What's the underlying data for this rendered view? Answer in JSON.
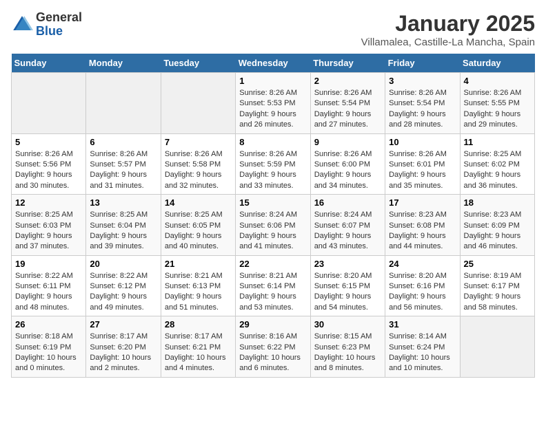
{
  "logo": {
    "general": "General",
    "blue": "Blue"
  },
  "title": "January 2025",
  "subtitle": "Villamalea, Castille-La Mancha, Spain",
  "days_of_week": [
    "Sunday",
    "Monday",
    "Tuesday",
    "Wednesday",
    "Thursday",
    "Friday",
    "Saturday"
  ],
  "weeks": [
    [
      {
        "day": "",
        "info": ""
      },
      {
        "day": "",
        "info": ""
      },
      {
        "day": "",
        "info": ""
      },
      {
        "day": "1",
        "info": "Sunrise: 8:26 AM\nSunset: 5:53 PM\nDaylight: 9 hours and 26 minutes."
      },
      {
        "day": "2",
        "info": "Sunrise: 8:26 AM\nSunset: 5:54 PM\nDaylight: 9 hours and 27 minutes."
      },
      {
        "day": "3",
        "info": "Sunrise: 8:26 AM\nSunset: 5:54 PM\nDaylight: 9 hours and 28 minutes."
      },
      {
        "day": "4",
        "info": "Sunrise: 8:26 AM\nSunset: 5:55 PM\nDaylight: 9 hours and 29 minutes."
      }
    ],
    [
      {
        "day": "5",
        "info": "Sunrise: 8:26 AM\nSunset: 5:56 PM\nDaylight: 9 hours and 30 minutes."
      },
      {
        "day": "6",
        "info": "Sunrise: 8:26 AM\nSunset: 5:57 PM\nDaylight: 9 hours and 31 minutes."
      },
      {
        "day": "7",
        "info": "Sunrise: 8:26 AM\nSunset: 5:58 PM\nDaylight: 9 hours and 32 minutes."
      },
      {
        "day": "8",
        "info": "Sunrise: 8:26 AM\nSunset: 5:59 PM\nDaylight: 9 hours and 33 minutes."
      },
      {
        "day": "9",
        "info": "Sunrise: 8:26 AM\nSunset: 6:00 PM\nDaylight: 9 hours and 34 minutes."
      },
      {
        "day": "10",
        "info": "Sunrise: 8:26 AM\nSunset: 6:01 PM\nDaylight: 9 hours and 35 minutes."
      },
      {
        "day": "11",
        "info": "Sunrise: 8:25 AM\nSunset: 6:02 PM\nDaylight: 9 hours and 36 minutes."
      }
    ],
    [
      {
        "day": "12",
        "info": "Sunrise: 8:25 AM\nSunset: 6:03 PM\nDaylight: 9 hours and 37 minutes."
      },
      {
        "day": "13",
        "info": "Sunrise: 8:25 AM\nSunset: 6:04 PM\nDaylight: 9 hours and 39 minutes."
      },
      {
        "day": "14",
        "info": "Sunrise: 8:25 AM\nSunset: 6:05 PM\nDaylight: 9 hours and 40 minutes."
      },
      {
        "day": "15",
        "info": "Sunrise: 8:24 AM\nSunset: 6:06 PM\nDaylight: 9 hours and 41 minutes."
      },
      {
        "day": "16",
        "info": "Sunrise: 8:24 AM\nSunset: 6:07 PM\nDaylight: 9 hours and 43 minutes."
      },
      {
        "day": "17",
        "info": "Sunrise: 8:23 AM\nSunset: 6:08 PM\nDaylight: 9 hours and 44 minutes."
      },
      {
        "day": "18",
        "info": "Sunrise: 8:23 AM\nSunset: 6:09 PM\nDaylight: 9 hours and 46 minutes."
      }
    ],
    [
      {
        "day": "19",
        "info": "Sunrise: 8:22 AM\nSunset: 6:11 PM\nDaylight: 9 hours and 48 minutes."
      },
      {
        "day": "20",
        "info": "Sunrise: 8:22 AM\nSunset: 6:12 PM\nDaylight: 9 hours and 49 minutes."
      },
      {
        "day": "21",
        "info": "Sunrise: 8:21 AM\nSunset: 6:13 PM\nDaylight: 9 hours and 51 minutes."
      },
      {
        "day": "22",
        "info": "Sunrise: 8:21 AM\nSunset: 6:14 PM\nDaylight: 9 hours and 53 minutes."
      },
      {
        "day": "23",
        "info": "Sunrise: 8:20 AM\nSunset: 6:15 PM\nDaylight: 9 hours and 54 minutes."
      },
      {
        "day": "24",
        "info": "Sunrise: 8:20 AM\nSunset: 6:16 PM\nDaylight: 9 hours and 56 minutes."
      },
      {
        "day": "25",
        "info": "Sunrise: 8:19 AM\nSunset: 6:17 PM\nDaylight: 9 hours and 58 minutes."
      }
    ],
    [
      {
        "day": "26",
        "info": "Sunrise: 8:18 AM\nSunset: 6:19 PM\nDaylight: 10 hours and 0 minutes."
      },
      {
        "day": "27",
        "info": "Sunrise: 8:17 AM\nSunset: 6:20 PM\nDaylight: 10 hours and 2 minutes."
      },
      {
        "day": "28",
        "info": "Sunrise: 8:17 AM\nSunset: 6:21 PM\nDaylight: 10 hours and 4 minutes."
      },
      {
        "day": "29",
        "info": "Sunrise: 8:16 AM\nSunset: 6:22 PM\nDaylight: 10 hours and 6 minutes."
      },
      {
        "day": "30",
        "info": "Sunrise: 8:15 AM\nSunset: 6:23 PM\nDaylight: 10 hours and 8 minutes."
      },
      {
        "day": "31",
        "info": "Sunrise: 8:14 AM\nSunset: 6:24 PM\nDaylight: 10 hours and 10 minutes."
      },
      {
        "day": "",
        "info": ""
      }
    ]
  ]
}
